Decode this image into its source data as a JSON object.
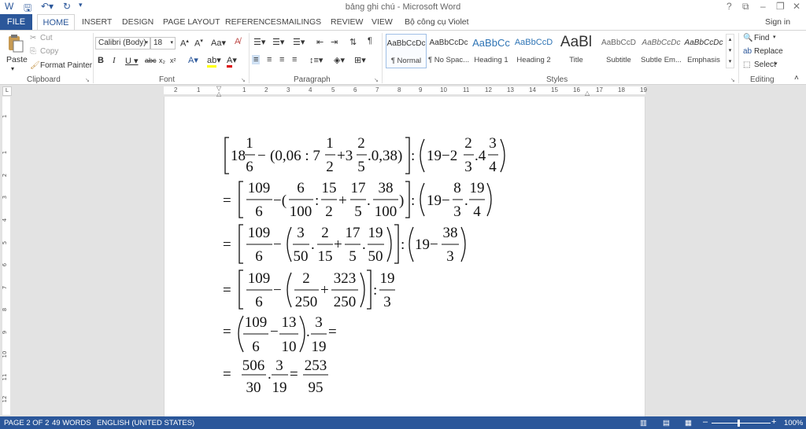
{
  "window": {
    "title": "bảng ghi chú - Microsoft Word",
    "help": "?",
    "signin": "Sign in"
  },
  "tabs": [
    "FILE",
    "HOME",
    "INSERT",
    "DESIGN",
    "PAGE LAYOUT",
    "REFERENCES",
    "MAILINGS",
    "REVIEW",
    "VIEW",
    "Bộ công cụ Violet"
  ],
  "clipboard": {
    "paste": "Paste",
    "cut": "Cut",
    "copy": "Copy",
    "format_painter": "Format Painter",
    "label": "Clipboard"
  },
  "font": {
    "name": "Calibri (Body)",
    "size": "18",
    "label": "Font"
  },
  "paragraph": {
    "label": "Paragraph"
  },
  "styles": {
    "items": [
      {
        "preview": "AaBbCcDc",
        "name": "¶ Normal"
      },
      {
        "preview": "AaBbCcDc",
        "name": "¶ No Spac..."
      },
      {
        "preview": "AaBbCc",
        "name": "Heading 1"
      },
      {
        "preview": "AaBbCcD",
        "name": "Heading 2"
      },
      {
        "preview": "AaBl",
        "name": "Title"
      },
      {
        "preview": "AaBbCcD",
        "name": "Subtitle"
      },
      {
        "preview": "AaBbCcDc",
        "name": "Subtle Em..."
      },
      {
        "preview": "AaBbCcDc",
        "name": "Emphasis"
      }
    ],
    "label": "Styles"
  },
  "editing": {
    "find": "Find",
    "replace": "Replace",
    "select": "Select",
    "label": "Editing"
  },
  "ruler": {
    "numbers": [
      "2",
      "1",
      "1",
      "2",
      "3",
      "4",
      "5",
      "6",
      "7",
      "8",
      "9",
      "10",
      "11",
      "12",
      "13",
      "14",
      "15",
      "16",
      "17",
      "18",
      "19"
    ]
  },
  "vruler": {
    "numbers": [
      "1",
      "1",
      "2",
      "3",
      "4",
      "5",
      "6",
      "7",
      "8",
      "9",
      "10",
      "11",
      "12"
    ]
  },
  "document": {
    "line1": {
      "n1": "18",
      "f1": [
        "1",
        "6"
      ],
      "minus": "−",
      "paren": "(0,06 : 7",
      "f2": [
        "1",
        "2"
      ],
      "plus": "+3",
      "f3": [
        "2",
        "5"
      ],
      "tail": ".0,38)",
      "colon": ":",
      "n2": "19−2",
      "f4": [
        "2",
        "3"
      ],
      "dot": ".4",
      "f5": [
        "3",
        "4"
      ]
    },
    "line2": {
      "f1": [
        "109",
        "6"
      ],
      "f2": [
        "6",
        "100"
      ],
      "f3": [
        "15",
        "2"
      ],
      "f4": [
        "17",
        "5"
      ],
      "f5": [
        "38",
        "100"
      ],
      "n": "19−",
      "f6": [
        "8",
        "3"
      ],
      "f7": [
        "19",
        "4"
      ]
    },
    "line3": {
      "f1": [
        "109",
        "6"
      ],
      "f2": [
        "3",
        "50"
      ],
      "f3": [
        "2",
        "15"
      ],
      "f4": [
        "17",
        "5"
      ],
      "f5": [
        "19",
        "50"
      ],
      "n": "19−",
      "f6": [
        "38",
        "3"
      ]
    },
    "line4": {
      "f1": [
        "109",
        "6"
      ],
      "f2": [
        "2",
        "250"
      ],
      "f3": [
        "323",
        "250"
      ],
      "f4": [
        "19",
        "3"
      ]
    },
    "line5": {
      "f1": [
        "109",
        "6"
      ],
      "f2": [
        "13",
        "10"
      ],
      "f3": [
        "3",
        "19"
      ]
    },
    "line6": {
      "f1": [
        "506",
        "30"
      ],
      "f2": [
        "3",
        "19"
      ],
      "f3": [
        "253",
        "95"
      ]
    }
  },
  "status": {
    "page": "PAGE 2 OF 2",
    "words": "49 WORDS",
    "language": "ENGLISH (UNITED STATES)",
    "zoom": "100%"
  }
}
